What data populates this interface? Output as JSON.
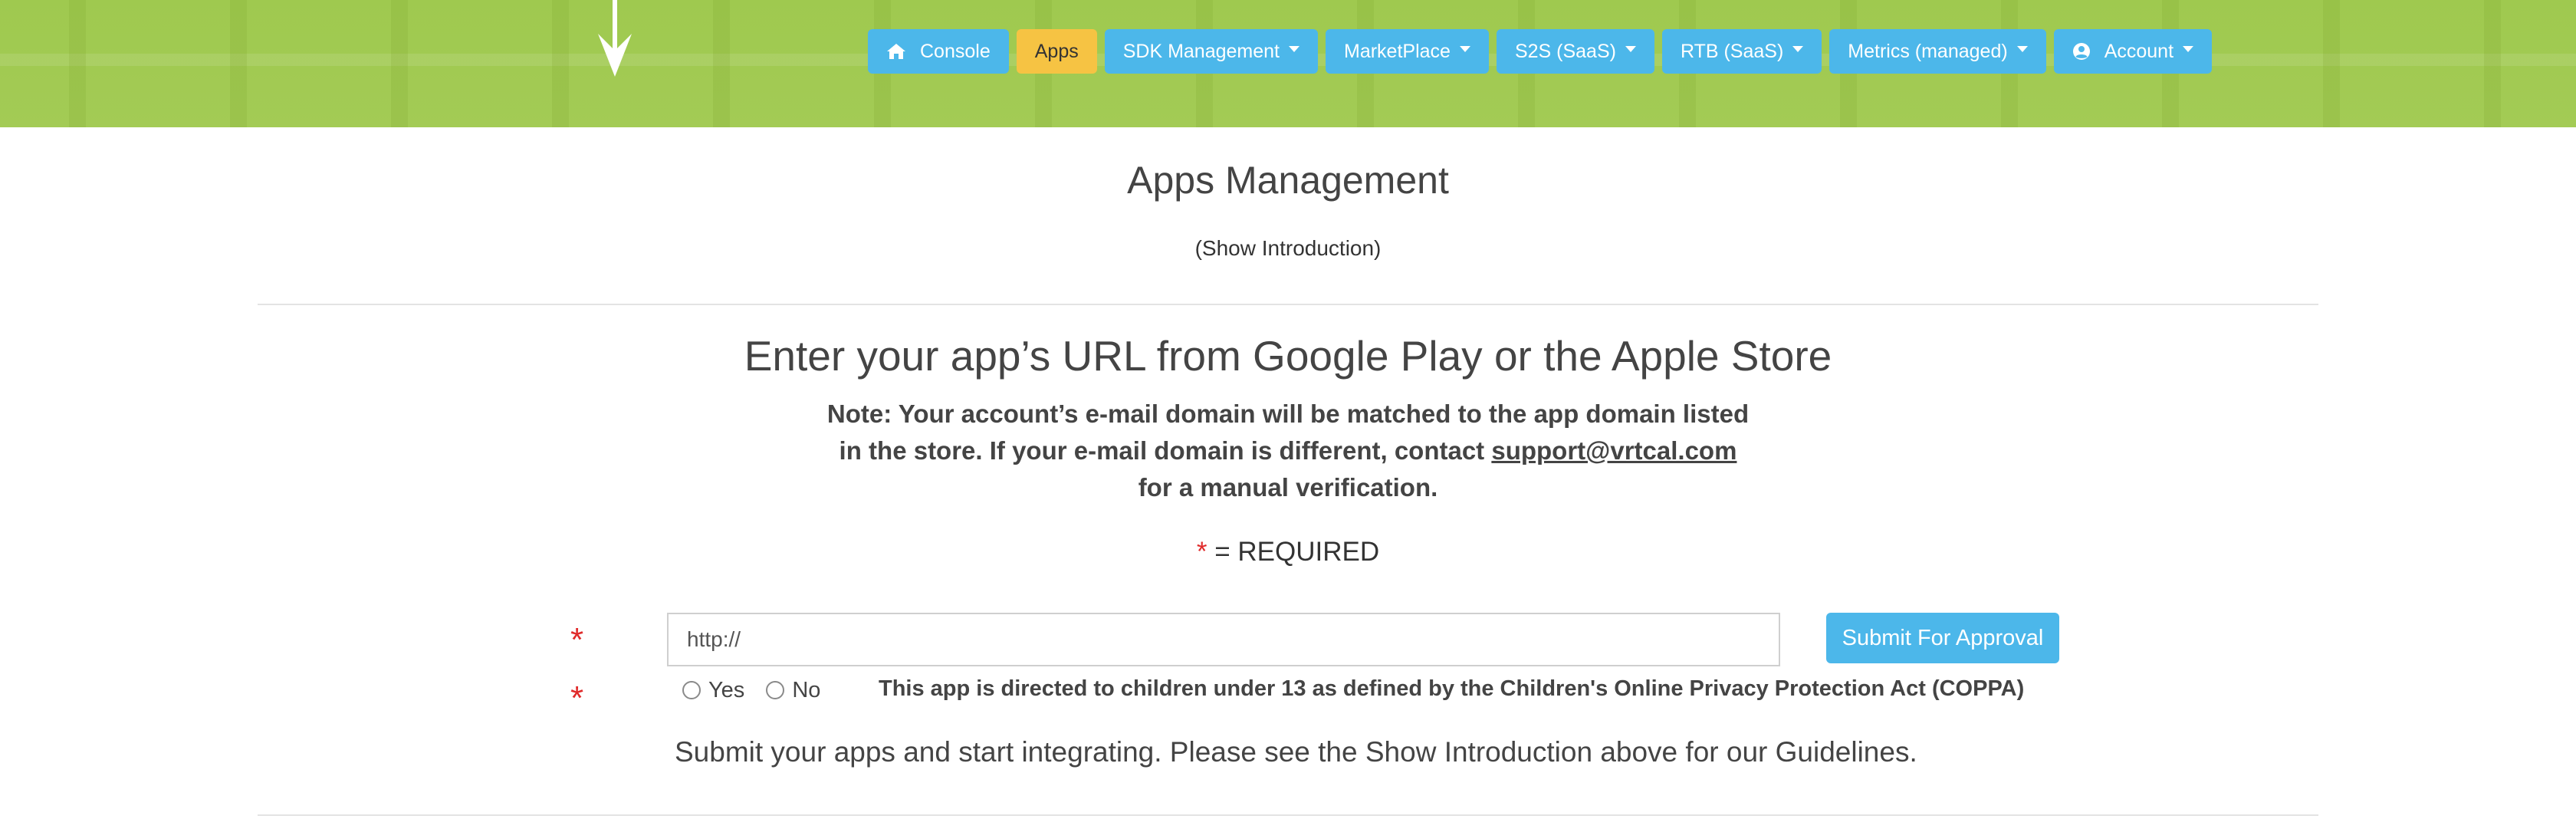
{
  "nav": {
    "items": [
      {
        "label": "Console",
        "icon": "home-icon",
        "active": false,
        "dropdown": false
      },
      {
        "label": "Apps",
        "active": true,
        "dropdown": false
      },
      {
        "label": "SDK Management",
        "active": false,
        "dropdown": true
      },
      {
        "label": "MarketPlace",
        "active": false,
        "dropdown": true
      },
      {
        "label": "S2S (SaaS)",
        "active": false,
        "dropdown": true
      },
      {
        "label": "RTB (SaaS)",
        "active": false,
        "dropdown": true
      },
      {
        "label": "Metrics (managed)",
        "active": false,
        "dropdown": true
      },
      {
        "label": "Account",
        "icon": "user-circle-icon",
        "active": false,
        "dropdown": true
      }
    ]
  },
  "page": {
    "title": "Apps Management",
    "show_intro": "(Show Introduction)"
  },
  "form": {
    "heading": "Enter your app’s URL from Google Play or the Apple Store",
    "note_line1": "Note: Your account’s e-mail domain will be matched to the app domain listed",
    "note_line2_pre": "in the store. If your e-mail domain is different, contact ",
    "note_email": "support@vrtcal.com",
    "note_line3": "for a manual verification.",
    "required_star": "*",
    "required_text": " = REQUIRED",
    "url_value": "http://",
    "submit_label": "Submit For Approval",
    "radio_yes": "Yes",
    "radio_no": "No",
    "coppa_text": "This app is directed to children under 13 as defined by the Children's Online Privacy Protection Act (COPPA)",
    "submit_message": "Submit your apps and start integrating. Please see the Show Introduction above for our Guidelines."
  },
  "colors": {
    "header_green": "#a3cb55",
    "nav_blue": "#4cb7ea",
    "nav_active": "#f6c343",
    "required_red": "#e02b2b"
  }
}
